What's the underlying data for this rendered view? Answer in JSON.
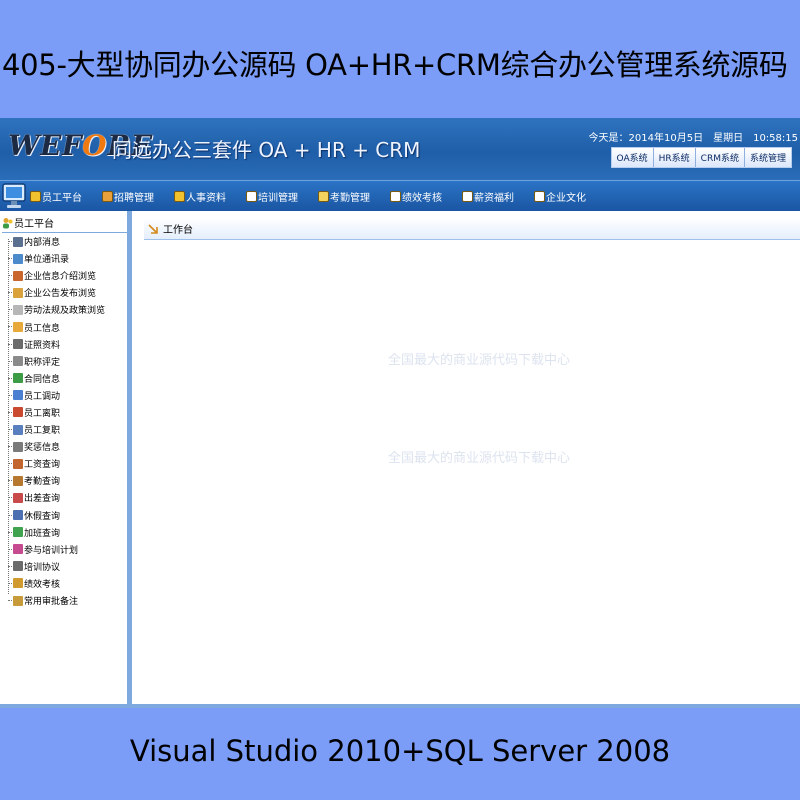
{
  "banner": {
    "top_text": "405-大型协同办公源码 OA+HR+CRM综合办公管理系统源码",
    "bottom_text": "Visual Studio 2010+SQL Server 2008"
  },
  "header": {
    "logo_prefix": "WEF",
    "logo_o": "O",
    "logo_suffix": "RE",
    "subtitle": "同远办公三套件 OA + HR + CRM",
    "date_text": "今天是：2014年10月5日　星期日　10:58:15",
    "system_tabs": [
      "OA系统",
      "HR系统",
      "CRM系统",
      "系统管理"
    ]
  },
  "nav": {
    "items": [
      {
        "label": "员工平台",
        "color": "#f2c12e"
      },
      {
        "label": "招聘管理",
        "color": "#e9a23b"
      },
      {
        "label": "人事资料",
        "color": "#f2c12e"
      },
      {
        "label": "培训管理",
        "color": "#ffffff"
      },
      {
        "label": "考勤管理",
        "color": "#f2d35e"
      },
      {
        "label": "绩效考核",
        "color": "#ffffff"
      },
      {
        "label": "薪资福利",
        "color": "#ffffff"
      },
      {
        "label": "企业文化",
        "color": "#ffffff"
      }
    ]
  },
  "sidebar": {
    "title": "员工平台",
    "items": [
      {
        "label": "内部消息",
        "color": "#5b6f8f"
      },
      {
        "label": "单位通讯录",
        "color": "#4b8acb"
      },
      {
        "label": "企业信息介绍浏览",
        "color": "#c9662e"
      },
      {
        "label": "企业公告发布浏览",
        "color": "#d9a23a"
      },
      {
        "label": "劳动法规及政策浏览",
        "color": "#b7b7b7"
      },
      {
        "label": "员工信息",
        "color": "#e7a93a"
      },
      {
        "label": "证照资料",
        "color": "#6b6b6b"
      },
      {
        "label": "职称评定",
        "color": "#8a8a8a"
      },
      {
        "label": "合同信息",
        "color": "#3c9b45"
      },
      {
        "label": "员工调动",
        "color": "#4b7fd1"
      },
      {
        "label": "员工离职",
        "color": "#c94a2e"
      },
      {
        "label": "员工复职",
        "color": "#5a7fbf"
      },
      {
        "label": "奖惩信息",
        "color": "#7a7a7a"
      },
      {
        "label": "工资查询",
        "color": "#c3652f"
      },
      {
        "label": "考勤查询",
        "color": "#b6772e"
      },
      {
        "label": "出差查询",
        "color": "#c94a4a"
      },
      {
        "label": "休假查询",
        "color": "#4b6fb1"
      },
      {
        "label": "加班查询",
        "color": "#3fa34f"
      },
      {
        "label": "参与培训计划",
        "color": "#c54a8f"
      },
      {
        "label": "培训协议",
        "color": "#6b6b6b"
      },
      {
        "label": "绩效考核",
        "color": "#d19a2f"
      },
      {
        "label": "常用审批备注",
        "color": "#c79a3a"
      }
    ]
  },
  "content": {
    "breadcrumb": "工作台",
    "watermark_1": "全国最大的商业源代码下载中心",
    "watermark_2": "全国最大的商业源代码下载中心"
  }
}
